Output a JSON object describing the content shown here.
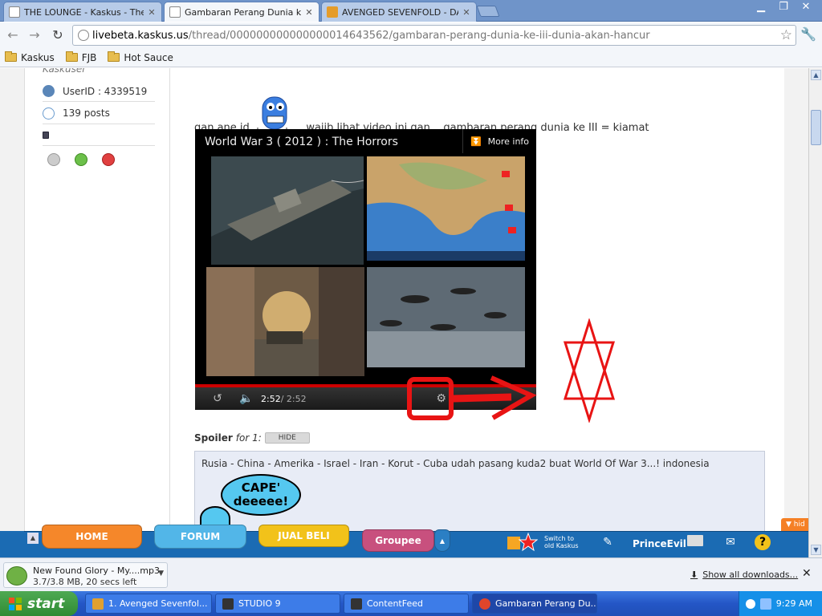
{
  "browser": {
    "tabs": [
      {
        "title": "THE LOUNGE - Kaskus - The La",
        "active": false
      },
      {
        "title": "Gambaran Perang Dunia ke III",
        "active": true
      },
      {
        "title": "AVENGED SEVENFOLD - DANC",
        "active": false
      }
    ],
    "url_domain": "livebeta.kaskus.us",
    "url_path": "/thread/000000000000000014643562/gambaran-perang-dunia-ke-iii-dunia-akan-hancur",
    "bookmarks": [
      "Kaskus",
      "FJB",
      "Hot Sauce"
    ]
  },
  "sidebar": {
    "rank": "Kaskuser",
    "user_id": "UserID : 4339519",
    "posts": "139 posts"
  },
  "post": {
    "text_before": "gan ane jd",
    "text_after": "... wajib lihat video ini gan... gambaran perang dunia ke III = kiamat",
    "video": {
      "title": "World War 3 ( 2012 ) : The Horrors",
      "more_info": "More info",
      "time_current": "2:52",
      "time_total": " / 2:52",
      "progress": 1.0
    },
    "spoiler_label": "Spoiler",
    "spoiler_for": "for 1:",
    "hide_button": "HIDE",
    "spoiler_text": "Rusia - China - Amerika - Israel - Iran - Korut - Cuba udah pasang kuda2 buat World Of War 3...! indonesia",
    "emoticon_text_1": "CAPE'",
    "emoticon_text_2": "deeeee!"
  },
  "kaskus_bar": {
    "home": "HOME",
    "forum": "FORUM",
    "jual_beli": "JUAL BELI",
    "groupee": "Groupee",
    "switch_line1": "Switch to",
    "switch_line2": "old Kaskus",
    "username": "PrinceEvil",
    "hide": "hid"
  },
  "downloads": {
    "file_name": "New Found Glory - My....mp3",
    "status": "3.7/3.8 MB, 20 secs left",
    "show_all": "Show all downloads..."
  },
  "taskbar": {
    "start": "start",
    "tasks": [
      "1. Avenged Sevenfol...",
      "STUDIO 9",
      "ContentFeed",
      "Gambaran Perang Du..."
    ],
    "clock": "9:29 AM"
  },
  "colors": {
    "kaskus_blue": "#1b6bb3",
    "home_tab": "#f5872a",
    "forum_tab": "#52b6e8",
    "jualbeli_tab": "#f2c21a",
    "groupee_tab": "#c8507e",
    "annotation_red": "#e81414"
  }
}
